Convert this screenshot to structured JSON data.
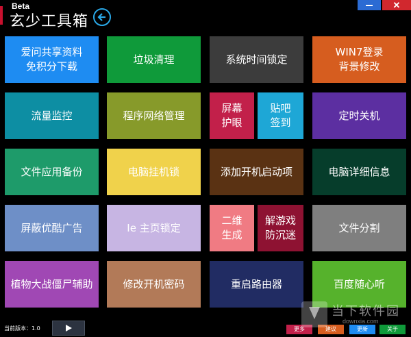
{
  "header": {
    "badge": "Beta",
    "title": "玄少工具箱"
  },
  "colors": {
    "background": "#000000",
    "back_button": "#2aa9e8",
    "minimize": "#2b6bd3",
    "close": "#d1282e"
  },
  "tiles": [
    {
      "label": "爱问共享资料免积分下载",
      "lines": [
        "爱问共享资料",
        "免积分下载"
      ],
      "color": "#1e8cf2"
    },
    {
      "label": "垃圾清理",
      "lines": [
        "垃圾清理"
      ],
      "color": "#0f9a3a"
    },
    {
      "label": "系统时间锁定",
      "lines": [
        "系统时间锁定"
      ],
      "color": "#3c3c3c"
    },
    {
      "label": "WIN7登录背景修改",
      "lines": [
        "WIN7登录",
        "背景修改"
      ],
      "color": "#d65d1f"
    },
    {
      "label": "流量监控",
      "lines": [
        "流量监控"
      ],
      "color": "#0d8ea3"
    },
    {
      "label": "程序网络管理",
      "lines": [
        "程序网络管理"
      ],
      "color": "#879a2a"
    },
    {
      "label": "屏幕护眼",
      "lines": [
        "屏幕",
        "护眼"
      ],
      "color": "#c2204a"
    },
    {
      "label": "贴吧签到",
      "lines": [
        "贴吧",
        "签到"
      ],
      "color": "#1ea7d6"
    },
    {
      "label": "定时关机",
      "lines": [
        "定时关机"
      ],
      "color": "#5c2fa1"
    },
    {
      "label": "文件应用备份",
      "lines": [
        "文件应用备份"
      ],
      "color": "#1e9b6a"
    },
    {
      "label": "电脑挂机锁",
      "lines": [
        "电脑挂机锁"
      ],
      "color": "#f0d24b"
    },
    {
      "label": "添加开机启动项",
      "lines": [
        "添加开机启动项"
      ],
      "color": "#5a3213"
    },
    {
      "label": "电脑详细信息",
      "lines": [
        "电脑详细信息"
      ],
      "color": "#063d2b"
    },
    {
      "label": "屏蔽优酷广告",
      "lines": [
        "屏蔽优酷广告"
      ],
      "color": "#6e8fc7"
    },
    {
      "label": "Ie 主页锁定",
      "lines": [
        "Ie 主页锁定"
      ],
      "color": "#c7b5e3"
    },
    {
      "label": "二维生成",
      "lines": [
        "二维",
        "生成"
      ],
      "color": "#f07b83"
    },
    {
      "label": "解游戏防沉迷",
      "lines": [
        "解游戏",
        "防沉迷"
      ],
      "color": "#8e1232"
    },
    {
      "label": "文件分割",
      "lines": [
        "文件分割"
      ],
      "color": "#7f7f7f"
    },
    {
      "label": "植物大战僵尸辅助",
      "lines": [
        "植物大战僵尸辅助"
      ],
      "color": "#a048b4"
    },
    {
      "label": "修改开机密码",
      "lines": [
        "修改开机密码"
      ],
      "color": "#b27a58"
    },
    {
      "label": "重启路由器",
      "lines": [
        "重启路由器"
      ],
      "color": "#212c63"
    },
    {
      "label": "百度随心听",
      "lines": [
        "百度随心听"
      ],
      "color": "#56b22c"
    }
  ],
  "footer": {
    "version": "当前版本：1.0",
    "buttons": [
      {
        "label": "更多",
        "color": "#c2204a"
      },
      {
        "label": "建议",
        "color": "#d65d1f"
      },
      {
        "label": "更新",
        "color": "#1e8cf2"
      },
      {
        "label": "关于",
        "color": "#0f9a3a"
      }
    ]
  },
  "watermark": {
    "text": "当下软件园",
    "sub": "downxia.com"
  }
}
